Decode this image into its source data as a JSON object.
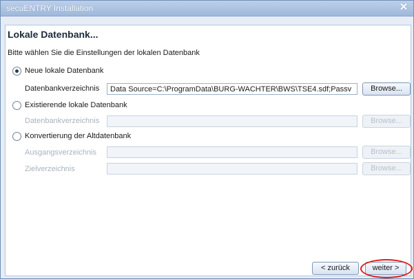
{
  "window": {
    "title": "secuENTRY Installation",
    "close_icon": "close-icon"
  },
  "page": {
    "header": "Lokale Datenbank...",
    "subtitle": "Bitte wählen Sie die Einstellungen der lokalen Datenbank"
  },
  "options": [
    {
      "label": "Neue lokale Datenbank",
      "selected": true,
      "fields": [
        {
          "label": "Datenbankverzeichnis",
          "value": "Data Source=C:\\ProgramData\\BURG-WACHTER\\BWS\\TSE4.sdf;Passv",
          "enabled": true,
          "button": "Browse..."
        }
      ]
    },
    {
      "label": "Existierende lokale Datenbank",
      "selected": false,
      "fields": [
        {
          "label": "Datenbankverzeichnis",
          "value": "",
          "enabled": false,
          "button": "Browse..."
        }
      ]
    },
    {
      "label": "Konvertierung der Altdatenbank",
      "selected": false,
      "fields": [
        {
          "label": "Ausgangsverzeichnis",
          "value": "",
          "enabled": false,
          "button": "Browse..."
        },
        {
          "label": "Zielverzeichnis",
          "value": "",
          "enabled": false,
          "button": "Browse..."
        }
      ]
    }
  ],
  "footer": {
    "back_label": "< zurück",
    "next_label": "weiter >"
  },
  "colors": {
    "highlight_ring": "#e11919",
    "accent": "#9fb8da"
  }
}
